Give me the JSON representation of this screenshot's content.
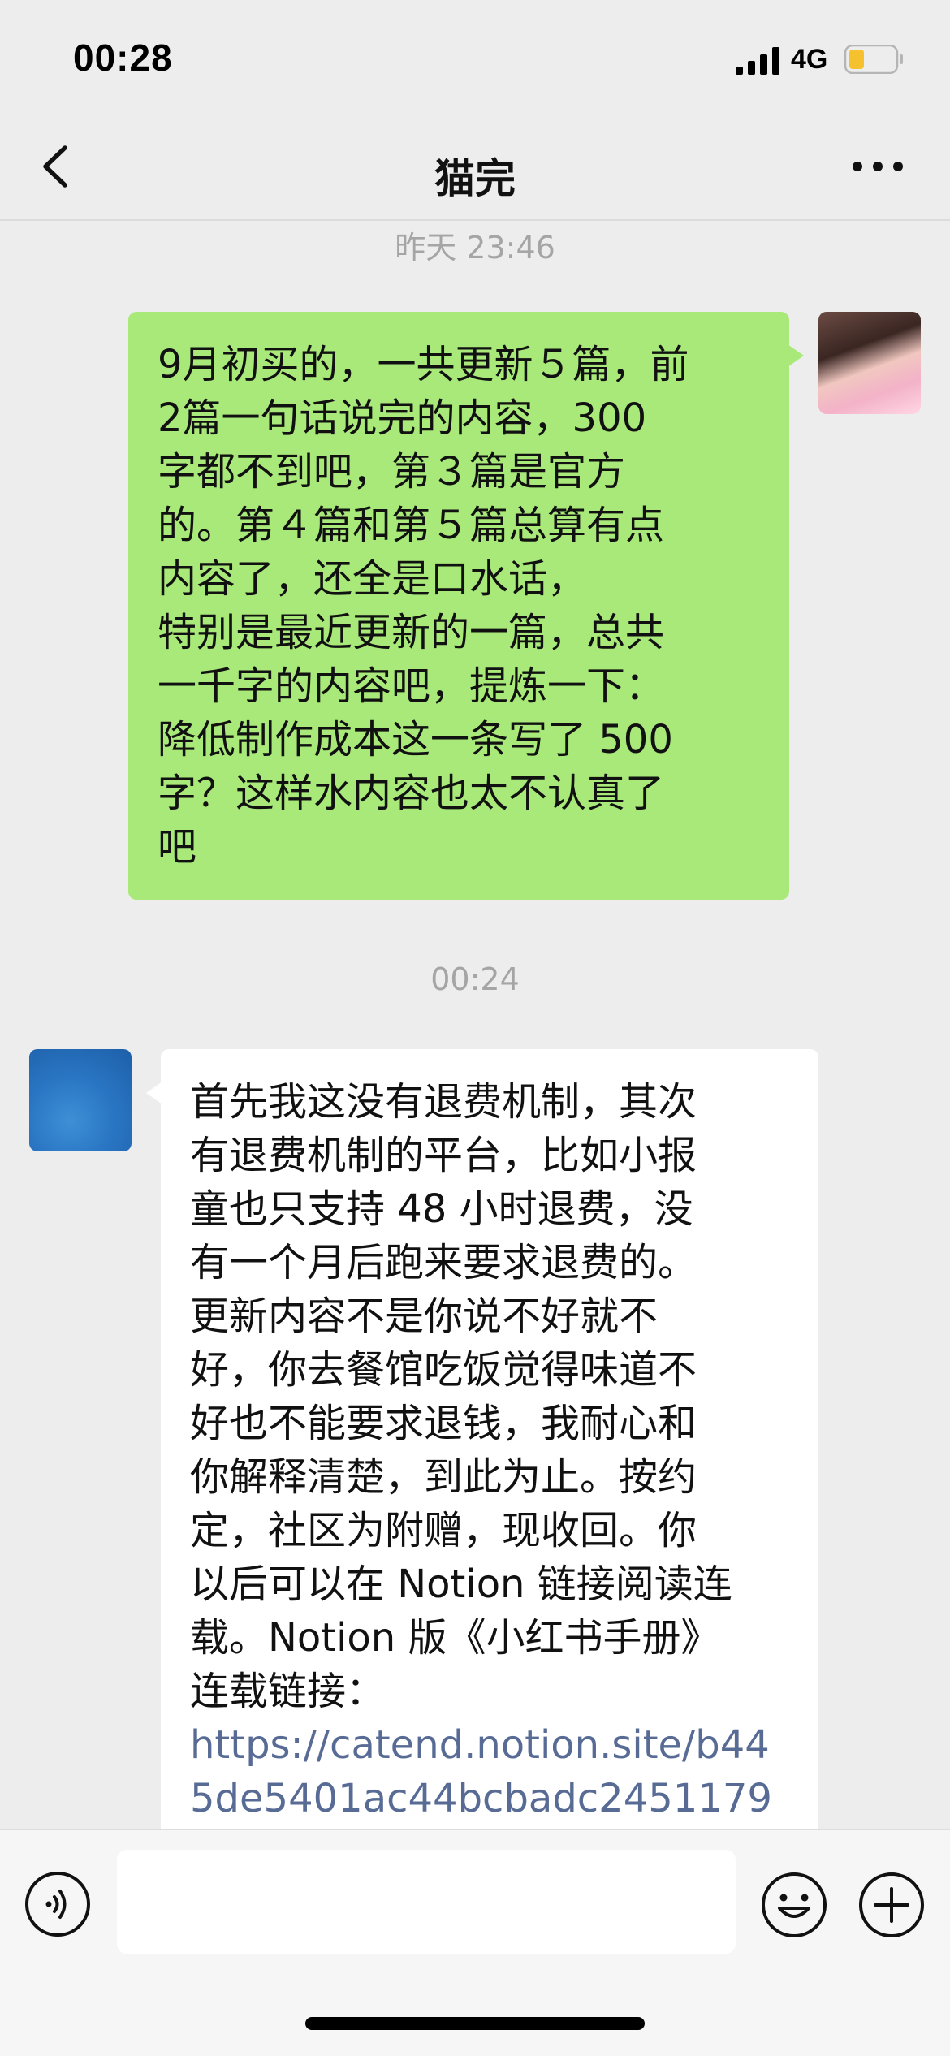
{
  "status_bar": {
    "time": "00:28",
    "network": "4G",
    "icons": [
      "signal-icon",
      "battery-icon"
    ],
    "battery_color": "#f5c12e"
  },
  "nav": {
    "title": "猫完",
    "icons": [
      "chevron-left-icon",
      "more-dots-icon"
    ]
  },
  "chat": {
    "timestamp_1": "昨天 23:46",
    "timestamp_2": "00:24",
    "bubble_colors": {
      "sent": "#a9e97a",
      "received": "#ffffff",
      "link": "#576b95"
    },
    "sent_message": {
      "lines": [
        "9月初买的，一共更新５篇，前",
        "2篇一句话说完的内容，300",
        "字都不到吧，第３篇是官方",
        "的。第４篇和第５篇总算有点",
        "内容了，还全是口水话，",
        "特别是最近更新的一篇，总共",
        "一千字的内容吧，提炼一下：",
        "降低制作成本这一条写了 500",
        "字？这样水内容也太不认真了",
        "吧"
      ]
    },
    "received_message": {
      "lines": [
        "首先我这没有退费机制，其次",
        "有退费机制的平台，比如小报",
        "童也只支持 48 小时退费，没",
        "有一个月后跑来要求退费的。",
        "更新内容不是你说不好就不",
        "好，你去餐馆吃饭觉得味道不",
        "好也不能要求退钱，我耐心和",
        "你解释清楚，到此为止。按约",
        "定，社区为附赠，现收回。你",
        "以后可以在 Notion 链接阅读连",
        "载。Notion 版《小红书手册》",
        "连载链接："
      ],
      "link_lines": [
        "https://catend.notion.site/b44",
        "5de5401ac44bcbadc2451179"
      ]
    }
  },
  "input_bar": {
    "message_value": "",
    "icons": [
      "voice-icon",
      "emoji-icon",
      "plus-icon"
    ]
  }
}
